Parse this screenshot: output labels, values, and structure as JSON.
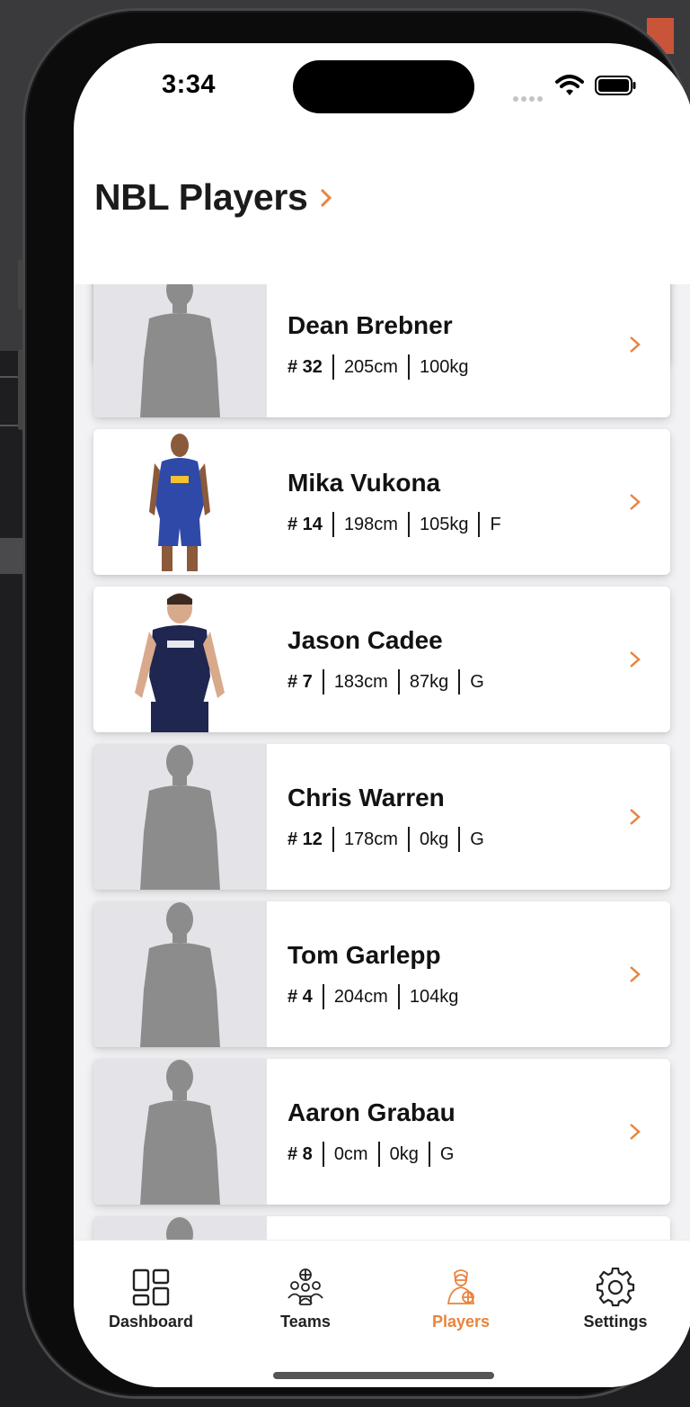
{
  "status": {
    "time": "3:34"
  },
  "header": {
    "title": "NBL Players"
  },
  "accent_color": "#e8843e",
  "players": [
    {
      "name": "Dean Brebner",
      "number": "# 32",
      "height": "205cm",
      "weight": "100kg",
      "position": "",
      "photo": "placeholder-silhouette"
    },
    {
      "name": "Mika Vukona",
      "number": "# 14",
      "height": "198cm",
      "weight": "105kg",
      "position": "F",
      "photo": "player-photo"
    },
    {
      "name": "Jason Cadee",
      "number": "# 7",
      "height": "183cm",
      "weight": "87kg",
      "position": "G",
      "photo": "player-photo"
    },
    {
      "name": "Chris Warren",
      "number": "# 12",
      "height": "178cm",
      "weight": "0kg",
      "position": "G",
      "photo": "placeholder-silhouette"
    },
    {
      "name": "Tom Garlepp",
      "number": "# 4",
      "height": "204cm",
      "weight": "104kg",
      "position": "",
      "photo": "placeholder-silhouette"
    },
    {
      "name": "Aaron Grabau",
      "number": "# 8",
      "height": "0cm",
      "weight": "0kg",
      "position": "G",
      "photo": "placeholder-silhouette"
    }
  ],
  "tabs": [
    {
      "label": "Dashboard",
      "icon": "dashboard-grid-icon"
    },
    {
      "label": "Teams",
      "icon": "teams-icon"
    },
    {
      "label": "Players",
      "icon": "players-icon",
      "active": true
    },
    {
      "label": "Settings",
      "icon": "gear-icon"
    }
  ]
}
